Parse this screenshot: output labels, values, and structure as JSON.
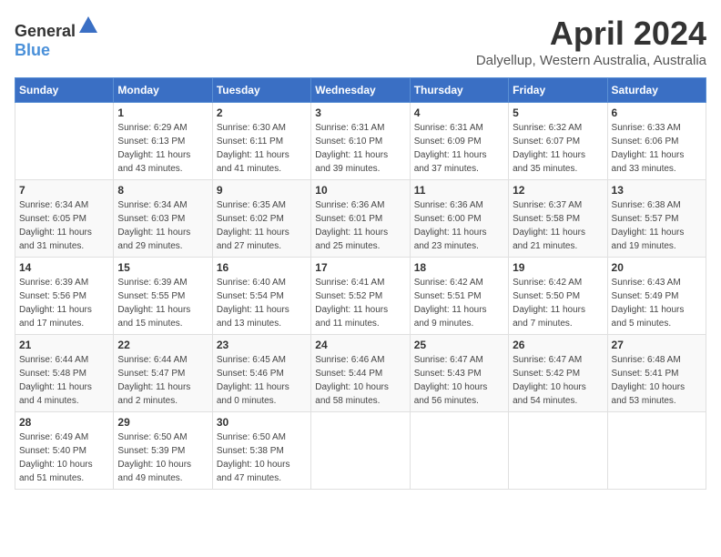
{
  "header": {
    "logo_general": "General",
    "logo_blue": "Blue",
    "month": "April 2024",
    "location": "Dalyellup, Western Australia, Australia"
  },
  "weekdays": [
    "Sunday",
    "Monday",
    "Tuesday",
    "Wednesday",
    "Thursday",
    "Friday",
    "Saturday"
  ],
  "weeks": [
    [
      {
        "day": "",
        "info": ""
      },
      {
        "day": "1",
        "info": "Sunrise: 6:29 AM\nSunset: 6:13 PM\nDaylight: 11 hours\nand 43 minutes."
      },
      {
        "day": "2",
        "info": "Sunrise: 6:30 AM\nSunset: 6:11 PM\nDaylight: 11 hours\nand 41 minutes."
      },
      {
        "day": "3",
        "info": "Sunrise: 6:31 AM\nSunset: 6:10 PM\nDaylight: 11 hours\nand 39 minutes."
      },
      {
        "day": "4",
        "info": "Sunrise: 6:31 AM\nSunset: 6:09 PM\nDaylight: 11 hours\nand 37 minutes."
      },
      {
        "day": "5",
        "info": "Sunrise: 6:32 AM\nSunset: 6:07 PM\nDaylight: 11 hours\nand 35 minutes."
      },
      {
        "day": "6",
        "info": "Sunrise: 6:33 AM\nSunset: 6:06 PM\nDaylight: 11 hours\nand 33 minutes."
      }
    ],
    [
      {
        "day": "7",
        "info": "Sunrise: 6:34 AM\nSunset: 6:05 PM\nDaylight: 11 hours\nand 31 minutes."
      },
      {
        "day": "8",
        "info": "Sunrise: 6:34 AM\nSunset: 6:03 PM\nDaylight: 11 hours\nand 29 minutes."
      },
      {
        "day": "9",
        "info": "Sunrise: 6:35 AM\nSunset: 6:02 PM\nDaylight: 11 hours\nand 27 minutes."
      },
      {
        "day": "10",
        "info": "Sunrise: 6:36 AM\nSunset: 6:01 PM\nDaylight: 11 hours\nand 25 minutes."
      },
      {
        "day": "11",
        "info": "Sunrise: 6:36 AM\nSunset: 6:00 PM\nDaylight: 11 hours\nand 23 minutes."
      },
      {
        "day": "12",
        "info": "Sunrise: 6:37 AM\nSunset: 5:58 PM\nDaylight: 11 hours\nand 21 minutes."
      },
      {
        "day": "13",
        "info": "Sunrise: 6:38 AM\nSunset: 5:57 PM\nDaylight: 11 hours\nand 19 minutes."
      }
    ],
    [
      {
        "day": "14",
        "info": "Sunrise: 6:39 AM\nSunset: 5:56 PM\nDaylight: 11 hours\nand 17 minutes."
      },
      {
        "day": "15",
        "info": "Sunrise: 6:39 AM\nSunset: 5:55 PM\nDaylight: 11 hours\nand 15 minutes."
      },
      {
        "day": "16",
        "info": "Sunrise: 6:40 AM\nSunset: 5:54 PM\nDaylight: 11 hours\nand 13 minutes."
      },
      {
        "day": "17",
        "info": "Sunrise: 6:41 AM\nSunset: 5:52 PM\nDaylight: 11 hours\nand 11 minutes."
      },
      {
        "day": "18",
        "info": "Sunrise: 6:42 AM\nSunset: 5:51 PM\nDaylight: 11 hours\nand 9 minutes."
      },
      {
        "day": "19",
        "info": "Sunrise: 6:42 AM\nSunset: 5:50 PM\nDaylight: 11 hours\nand 7 minutes."
      },
      {
        "day": "20",
        "info": "Sunrise: 6:43 AM\nSunset: 5:49 PM\nDaylight: 11 hours\nand 5 minutes."
      }
    ],
    [
      {
        "day": "21",
        "info": "Sunrise: 6:44 AM\nSunset: 5:48 PM\nDaylight: 11 hours\nand 4 minutes."
      },
      {
        "day": "22",
        "info": "Sunrise: 6:44 AM\nSunset: 5:47 PM\nDaylight: 11 hours\nand 2 minutes."
      },
      {
        "day": "23",
        "info": "Sunrise: 6:45 AM\nSunset: 5:46 PM\nDaylight: 11 hours\nand 0 minutes."
      },
      {
        "day": "24",
        "info": "Sunrise: 6:46 AM\nSunset: 5:44 PM\nDaylight: 10 hours\nand 58 minutes."
      },
      {
        "day": "25",
        "info": "Sunrise: 6:47 AM\nSunset: 5:43 PM\nDaylight: 10 hours\nand 56 minutes."
      },
      {
        "day": "26",
        "info": "Sunrise: 6:47 AM\nSunset: 5:42 PM\nDaylight: 10 hours\nand 54 minutes."
      },
      {
        "day": "27",
        "info": "Sunrise: 6:48 AM\nSunset: 5:41 PM\nDaylight: 10 hours\nand 53 minutes."
      }
    ],
    [
      {
        "day": "28",
        "info": "Sunrise: 6:49 AM\nSunset: 5:40 PM\nDaylight: 10 hours\nand 51 minutes."
      },
      {
        "day": "29",
        "info": "Sunrise: 6:50 AM\nSunset: 5:39 PM\nDaylight: 10 hours\nand 49 minutes."
      },
      {
        "day": "30",
        "info": "Sunrise: 6:50 AM\nSunset: 5:38 PM\nDaylight: 10 hours\nand 47 minutes."
      },
      {
        "day": "",
        "info": ""
      },
      {
        "day": "",
        "info": ""
      },
      {
        "day": "",
        "info": ""
      },
      {
        "day": "",
        "info": ""
      }
    ]
  ]
}
